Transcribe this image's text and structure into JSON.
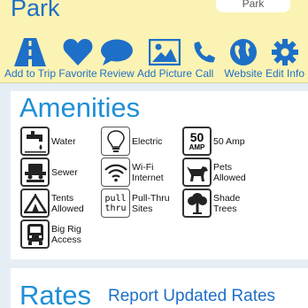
{
  "header": {
    "title": "Park",
    "button_label": "Park"
  },
  "toolbar": {
    "items": [
      {
        "label": "Add to Trip",
        "icon": "road-icon"
      },
      {
        "label": "Favorite",
        "icon": "heart-icon"
      },
      {
        "label": "Review",
        "icon": "speech-bubble-icon"
      },
      {
        "label": "Add Picture",
        "icon": "picture-icon"
      },
      {
        "label": "Call",
        "icon": "phone-icon"
      },
      {
        "label": "Website",
        "icon": "globe-icon"
      },
      {
        "label": "Edit Info",
        "icon": "gear-icon"
      }
    ]
  },
  "amenities": {
    "title": "Amenities",
    "items": [
      {
        "label": "Water",
        "icon": "water-faucet-icon"
      },
      {
        "label": "Electric",
        "icon": "lightbulb-icon"
      },
      {
        "label": "50 Amp",
        "icon": "50-amp-icon",
        "badge_top": "50",
        "badge_bottom": "AMP"
      },
      {
        "label": "Sewer",
        "icon": "sewer-icon"
      },
      {
        "label": "Wi-Fi\nInternet",
        "icon": "wifi-icon"
      },
      {
        "label": "Pets\nAllowed",
        "icon": "dog-icon"
      },
      {
        "label": "Tents\nAllowed",
        "icon": "tent-icon"
      },
      {
        "label": "Pull-Thru\nSites",
        "icon": "pull-thru-icon",
        "badge_top": "pull",
        "badge_bottom": "thru"
      },
      {
        "label": "Shade\nTrees",
        "icon": "tree-icon"
      },
      {
        "label": "Big Rig\nAccess",
        "icon": "truck-icon"
      }
    ]
  },
  "rates": {
    "title": "Rates",
    "report_label": "Report Updated Rates"
  },
  "colors": {
    "accent": "#1e6fc7",
    "title_blue": "#1e8fd6",
    "toolbar_bg": "#fbf3b3",
    "page_bg": "#e6eef5"
  }
}
